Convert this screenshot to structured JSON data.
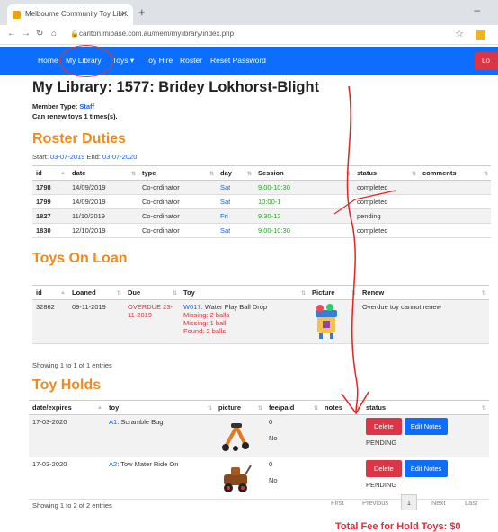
{
  "browser": {
    "tab_title": "Melbourne Community Toy Libr...",
    "url": "carlton.mibase.com.au/mem/mylibrary/index.php"
  },
  "navbar": {
    "items": [
      "Home",
      "My Library",
      "Toys ▾",
      "Toy Hire",
      "Roster",
      "Reset Password"
    ],
    "logout": "Lo"
  },
  "page": {
    "title": "My Library: 1577: Bridey Lokhorst-Blight",
    "member_type_label": "Member Type: ",
    "member_type": "Staff",
    "renew_text": "Can renew toys 1 times(s)."
  },
  "roster": {
    "heading": "Roster Duties",
    "start_label": "Start: ",
    "start": "03-07-2019",
    "end_label": " End: ",
    "end": "03-07-2020",
    "columns": [
      "id",
      "date",
      "type",
      "day",
      "Session",
      "status",
      "comments"
    ],
    "rows": [
      [
        "1798",
        "14/09/2019",
        "Co-ordinator",
        "Sat",
        "9.00-10:30",
        "completed",
        ""
      ],
      [
        "1799",
        "14/09/2019",
        "Co-ordinator",
        "Sat",
        "10:00-1",
        "completed",
        ""
      ],
      [
        "1827",
        "11/10/2019",
        "Co-ordinator",
        "Fri",
        "9.30-12",
        "pending",
        ""
      ],
      [
        "1830",
        "12/10/2019",
        "Co-ordinator",
        "Sat",
        "9.00-10:30",
        "completed",
        ""
      ]
    ]
  },
  "loans": {
    "heading": "Toys On Loan",
    "columns": [
      "id",
      "Loaned",
      "Due",
      "Toy",
      "Picture",
      "Renew"
    ],
    "row": {
      "id": "32862",
      "loaned": "09-11-2019",
      "due": "OVERDUE 23-11-2019",
      "toy_code": "W017",
      "toy_name": ": Water Play Ball Drop",
      "missing1": "Missing: 2 balls",
      "missing2": "Missing: 1 ball",
      "found": "Found: 2 balls",
      "renew": "Overdue toy cannot renew"
    },
    "info": "Showing 1 to 1 of 1 entries"
  },
  "holds": {
    "heading": "Toy Holds",
    "columns": [
      "date/expires",
      "toy",
      "picture",
      "fee/paid",
      "notes",
      "status"
    ],
    "rows": [
      {
        "date": "17-03-2020",
        "code": "A1",
        "name": ": Scramble Bug",
        "fee": "0",
        "paid": "No",
        "notes": "",
        "status": "PENDING"
      },
      {
        "date": "17-03-2020",
        "code": "A2",
        "name": ": Tow Mater Ride On",
        "fee": "0",
        "paid": "No",
        "notes": "",
        "status": "PENDING"
      }
    ],
    "delete_label": "Delete",
    "edit_label": "Edit Notes",
    "info": "Showing 1 to 2 of 2 entries",
    "pager": {
      "first": "First",
      "prev": "Previous",
      "current": "1",
      "next": "Next",
      "last": "Last"
    },
    "total": "Total Fee for Hold Toys: $0"
  },
  "colors": {
    "navbar": "#0d6efd",
    "heading": "#f08a1d",
    "danger": "#dc3545",
    "annotation": "#e32222"
  }
}
